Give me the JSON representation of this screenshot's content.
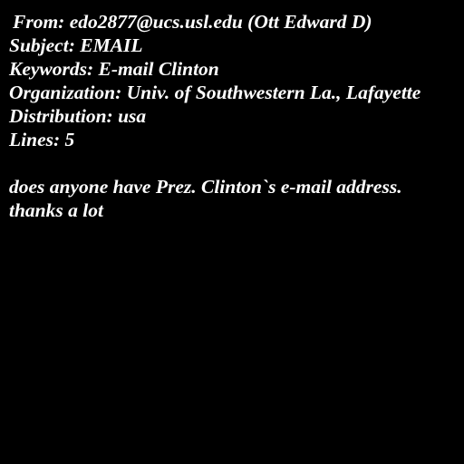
{
  "header": {
    "from": "From: edo2877@ucs.usl.edu (Ott Edward D)",
    "subject": "Subject: EMAIL",
    "keywords": "Keywords: E-mail Clinton",
    "organization": "Organization: Univ. of Southwestern La., Lafayette",
    "distribution": "Distribution: usa",
    "lines": "Lines: 5"
  },
  "body": {
    "line1": "does anyone have Prez. Clinton`s e-mail address.",
    "line2": "thanks a lot"
  },
  "colors": {
    "background": "#000000",
    "text": "#ffffff"
  }
}
